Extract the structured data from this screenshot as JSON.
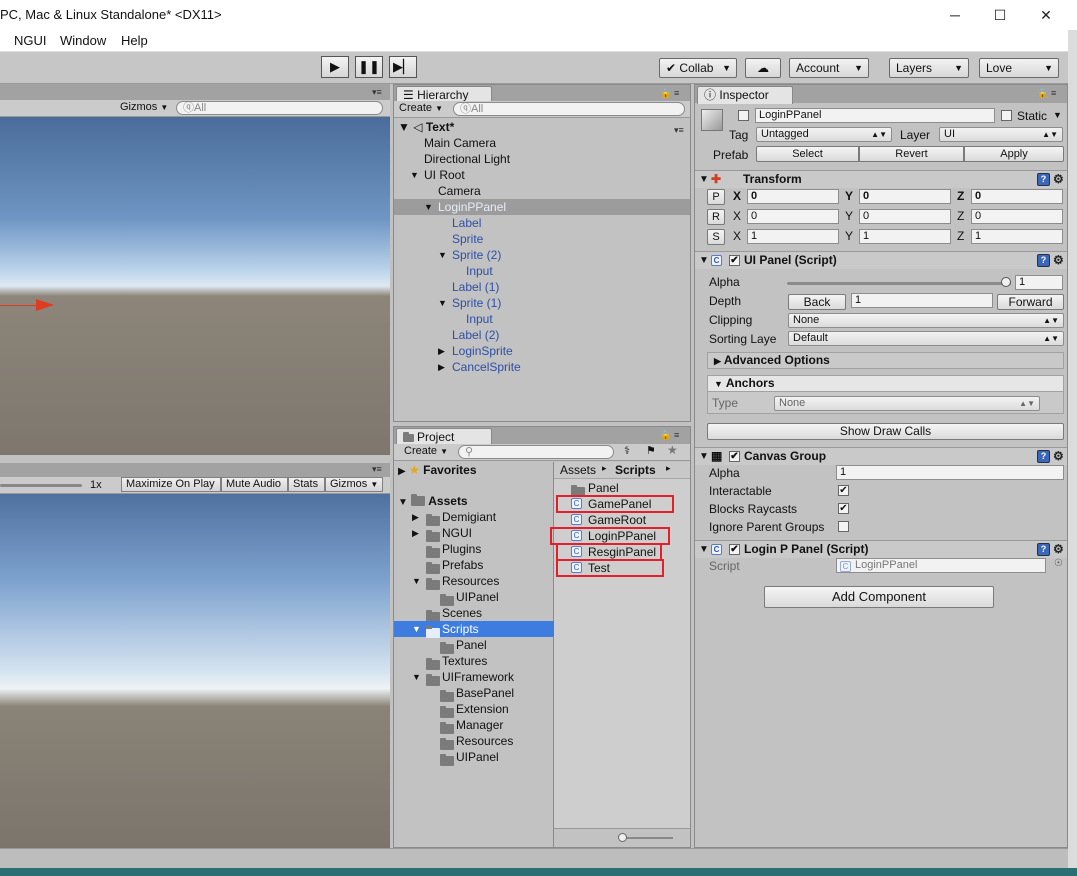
{
  "window": {
    "title": "PC, Mac & Linux Standalone* <DX11>",
    "minimize": "─",
    "maximize": "☐",
    "close": "✕"
  },
  "menu": [
    "NGUI",
    "Window",
    "Help"
  ],
  "toolbar": {
    "play": "▶",
    "pause": "❚❚",
    "step": "▶▏",
    "collab": "Collab",
    "account": "Account",
    "layers": "Layers",
    "layout": "Love"
  },
  "scene": {
    "gizmos": "Gizmos",
    "search_placeholder": "ⓠAll"
  },
  "game": {
    "scale": "1x",
    "maximize": "Maximize On Play",
    "mute": "Mute Audio",
    "stats": "Stats",
    "gizmos": "Gizmos"
  },
  "hierarchy": {
    "tab": "Hierarchy",
    "create": "Create",
    "search_placeholder": "ⓠAll",
    "scene_name": "Text*",
    "items": [
      {
        "label": "Main Camera",
        "indent": 0,
        "arrow": "",
        "color": "black"
      },
      {
        "label": "Directional Light",
        "indent": 0,
        "arrow": "",
        "color": "black"
      },
      {
        "label": "UI Root",
        "indent": 0,
        "arrow": "▼",
        "color": "black"
      },
      {
        "label": "Camera",
        "indent": 1,
        "arrow": "",
        "color": "black"
      },
      {
        "label": "LoginPPanel",
        "indent": 1,
        "arrow": "▼",
        "color": "blue",
        "selected": true
      },
      {
        "label": "Label",
        "indent": 2,
        "arrow": "",
        "color": "blue"
      },
      {
        "label": "Sprite",
        "indent": 2,
        "arrow": "",
        "color": "blue"
      },
      {
        "label": "Sprite (2)",
        "indent": 2,
        "arrow": "▼",
        "color": "blue"
      },
      {
        "label": "Input",
        "indent": 3,
        "arrow": "",
        "color": "blue"
      },
      {
        "label": "Label (1)",
        "indent": 2,
        "arrow": "",
        "color": "blue"
      },
      {
        "label": "Sprite (1)",
        "indent": 2,
        "arrow": "▼",
        "color": "blue"
      },
      {
        "label": "Input",
        "indent": 3,
        "arrow": "",
        "color": "blue"
      },
      {
        "label": "Label (2)",
        "indent": 2,
        "arrow": "",
        "color": "blue"
      },
      {
        "label": "LoginSprite",
        "indent": 2,
        "arrow": "▶",
        "color": "blue"
      },
      {
        "label": "CancelSprite",
        "indent": 2,
        "arrow": "▶",
        "color": "blue"
      }
    ]
  },
  "project": {
    "tab": "Project",
    "create": "Create",
    "favorites": "Favorites",
    "assets_root": "Assets",
    "tree": [
      {
        "label": "Demigiant",
        "indent": 1,
        "arrow": "▶"
      },
      {
        "label": "NGUI",
        "indent": 1,
        "arrow": "▶"
      },
      {
        "label": "Plugins",
        "indent": 1,
        "arrow": ""
      },
      {
        "label": "Prefabs",
        "indent": 1,
        "arrow": ""
      },
      {
        "label": "Resources",
        "indent": 1,
        "arrow": "▼"
      },
      {
        "label": "UIPanel",
        "indent": 2,
        "arrow": ""
      },
      {
        "label": "Scenes",
        "indent": 1,
        "arrow": ""
      },
      {
        "label": "Scripts",
        "indent": 1,
        "arrow": "▼",
        "selected": true
      },
      {
        "label": "Panel",
        "indent": 2,
        "arrow": ""
      },
      {
        "label": "Textures",
        "indent": 1,
        "arrow": ""
      },
      {
        "label": "UIFramework",
        "indent": 1,
        "arrow": "▼"
      },
      {
        "label": "BasePanel",
        "indent": 2,
        "arrow": ""
      },
      {
        "label": "Extension",
        "indent": 2,
        "arrow": ""
      },
      {
        "label": "Manager",
        "indent": 2,
        "arrow": ""
      },
      {
        "label": "Resources",
        "indent": 2,
        "arrow": ""
      },
      {
        "label": "UIPanel",
        "indent": 2,
        "arrow": ""
      }
    ],
    "breadcrumb": [
      "Assets",
      "Scripts"
    ],
    "files": [
      {
        "label": "Panel",
        "kind": "folder"
      },
      {
        "label": "GamePanel",
        "kind": "script",
        "highlight": true
      },
      {
        "label": "GameRoot",
        "kind": "script"
      },
      {
        "label": "LoginPPanel",
        "kind": "script",
        "highlight": true
      },
      {
        "label": "ResginPanel",
        "kind": "script",
        "highlight": true
      },
      {
        "label": "Test",
        "kind": "script",
        "highlight": true
      }
    ]
  },
  "inspector": {
    "tab": "Inspector",
    "name": "LoginPPanel",
    "static": "Static",
    "tag_label": "Tag",
    "tag": "Untagged",
    "layer_label": "Layer",
    "layer": "UI",
    "prefab_label": "Prefab",
    "select": "Select",
    "revert": "Revert",
    "apply": "Apply",
    "transform": {
      "title": "Transform",
      "p": "P",
      "r": "R",
      "s": "S",
      "position": [
        "0",
        "0",
        "0"
      ],
      "rotation": [
        "0",
        "0",
        "0"
      ],
      "scale": [
        "1",
        "1",
        "1"
      ],
      "axes": [
        "X",
        "Y",
        "Z"
      ]
    },
    "uipanel": {
      "title": "UI Panel (Script)",
      "alpha_label": "Alpha",
      "alpha": "1",
      "alpha_fraction": 1,
      "depth_label": "Depth",
      "back": "Back",
      "depth": "1",
      "forward": "Forward",
      "clipping_label": "Clipping",
      "clipping": "None",
      "sorting_label": "Sorting Laye",
      "sorting": "Default",
      "advanced": "Advanced Options",
      "anchors": "Anchors",
      "type_label": "Type",
      "type": "None",
      "draw_calls": "Show Draw Calls"
    },
    "canvas": {
      "title": "Canvas Group",
      "alpha_label": "Alpha",
      "alpha": "1",
      "interactable": "Interactable",
      "blocks": "Blocks Raycasts",
      "ignore": "Ignore Parent Groups"
    },
    "login": {
      "title": "Login P Panel (Script)",
      "script_label": "Script",
      "script": "LoginPPanel"
    },
    "add_component": "Add Component"
  },
  "colors": {
    "highlight_red": "#e0202a",
    "selection_blue": "#3e7ce0",
    "prefab_blue": "#2d4fa6"
  }
}
